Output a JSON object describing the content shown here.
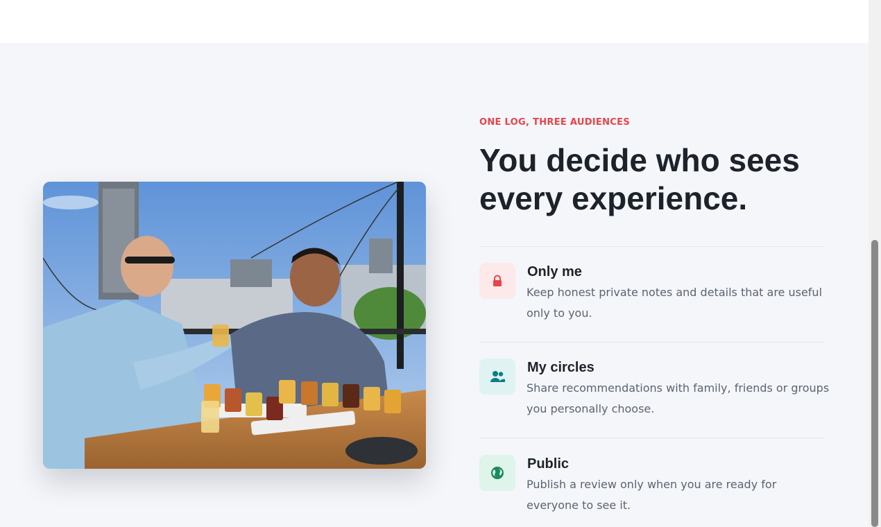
{
  "section": {
    "eyebrow": "ONE LOG, THREE AUDIENCES",
    "heading": "You decide who sees every experience."
  },
  "audiences": [
    {
      "title": "Only me",
      "description": "Keep honest private notes and details that are useful only to you.",
      "icon": "lock-icon",
      "icon_color": "#e8434a",
      "icon_bg": "#fde9ea"
    },
    {
      "title": "My circles",
      "description": "Share recommendations with family, friends or groups you personally choose.",
      "icon": "users-icon",
      "icon_color": "#0f7c86",
      "icon_bg": "#dff3f3"
    },
    {
      "title": "Public",
      "description": "Publish a review only when you are ready for everyone to see it.",
      "icon": "globe-icon",
      "icon_color": "#1d8a5b",
      "icon_bg": "#dff4ea"
    }
  ],
  "colors": {
    "accent": "#e8434a",
    "heading": "#1d232b",
    "body_text": "#5b6470",
    "section_bg": "#f4f6f9"
  }
}
